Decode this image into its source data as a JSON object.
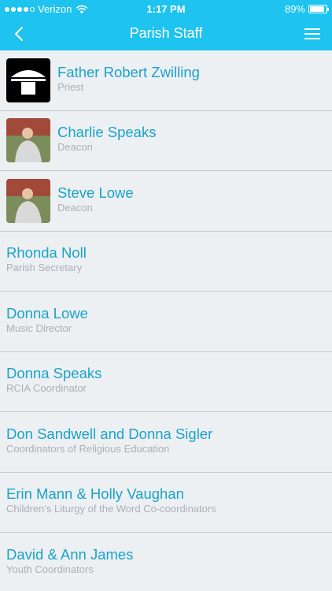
{
  "status_bar": {
    "carrier": "Verizon",
    "time": "1:17 PM",
    "battery": "89%",
    "battery_level": 0.89,
    "signal_bars": 4,
    "signal_total": 5
  },
  "header": {
    "title": "Parish Staff",
    "back_icon": "chevron-left-icon",
    "menu_icon": "hamburger-menu-icon",
    "color": "#1ec3ef"
  },
  "colors": {
    "name": "#1aa3c8",
    "role": "#aab0b5",
    "background": "#ecf0f3",
    "divider": "#c6cbcf"
  },
  "staff": [
    {
      "name": "Father Robert Zwilling",
      "role": "Priest",
      "photo": "logo"
    },
    {
      "name": "Charlie Speaks",
      "role": "Deacon",
      "photo": "person"
    },
    {
      "name": "Steve Lowe",
      "role": "Deacon",
      "photo": "person"
    },
    {
      "name": "Rhonda Noll",
      "role": "Parish Secretary"
    },
    {
      "name": "Donna Lowe",
      "role": "Music Director"
    },
    {
      "name": "Donna Speaks",
      "role": "RCIA Coordinator"
    },
    {
      "name": "Don Sandwell and Donna Sigler",
      "role": "Coordinators of Religious Education"
    },
    {
      "name": "Erin Mann & Holly Vaughan",
      "role": "Children's Liturgy of the Word Co-coordinators"
    },
    {
      "name": "David & Ann James",
      "role": "Youth Coordinators"
    }
  ]
}
